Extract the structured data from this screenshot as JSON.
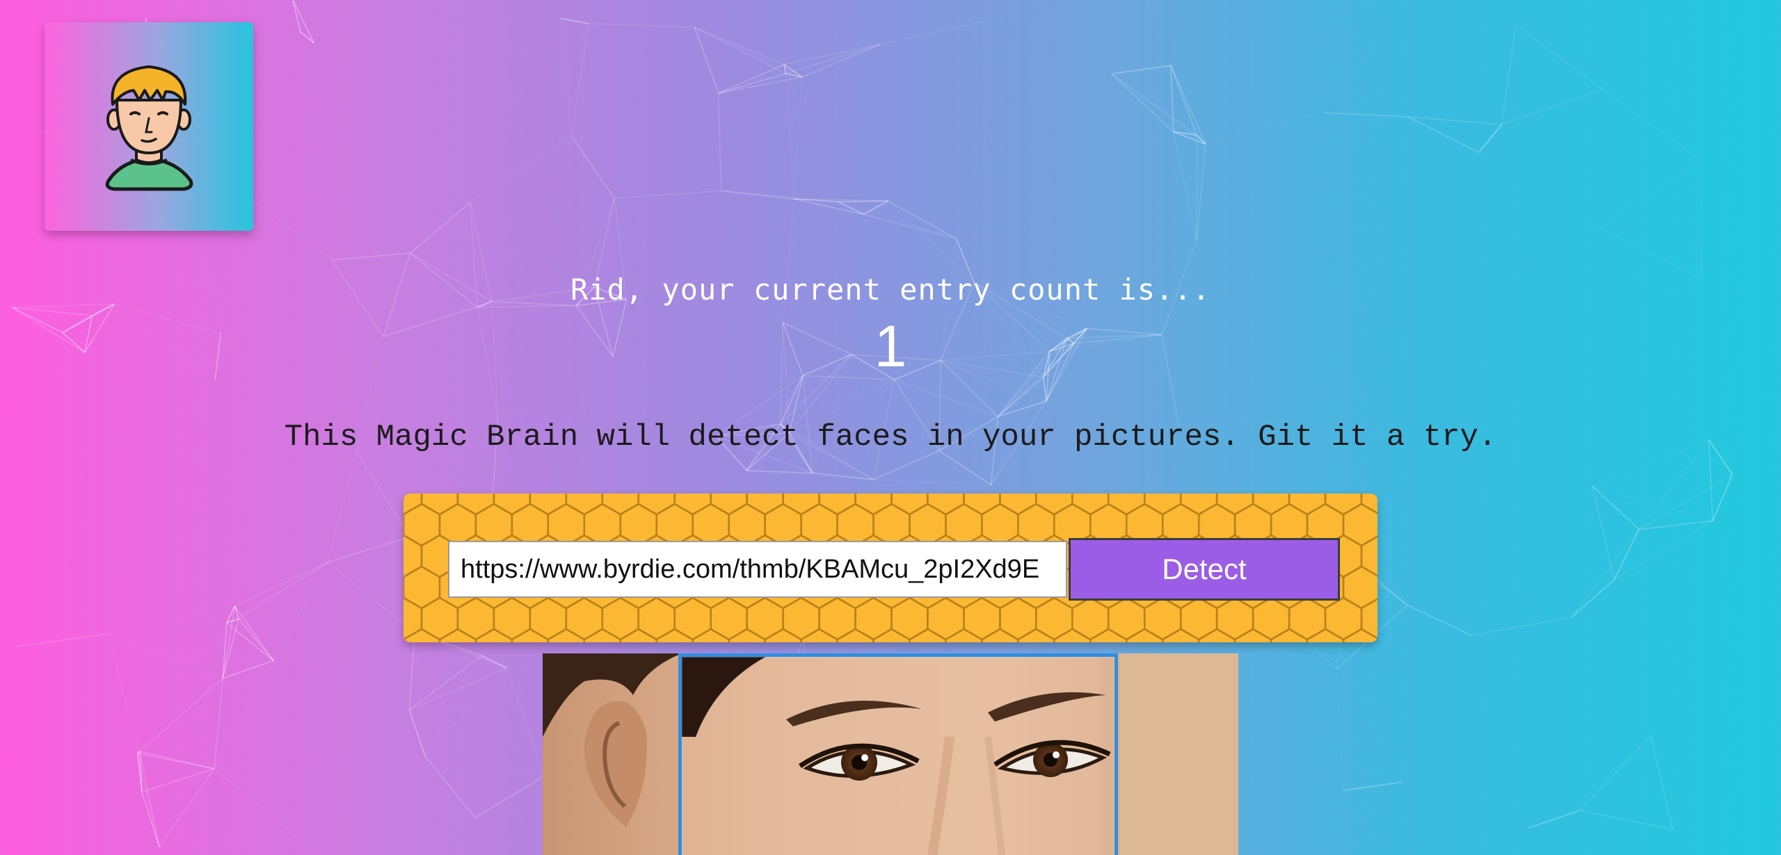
{
  "header": {
    "logo_icon": "brain-face-avatar"
  },
  "rank": {
    "message": "Rid, your current entry count is...",
    "count": "1"
  },
  "tagline": "This Magic Brain will detect faces in your pictures. Git it a try.",
  "image_link_form": {
    "url_value": "https://www.byrdie.com/thmb/KBAMcu_2pI2Xd9E",
    "detect_label": "Detect"
  },
  "colors": {
    "gradient_left": "#ff5edf",
    "gradient_right": "#22c9df",
    "panel": "#fcb833",
    "button": "#9b5de5",
    "bounding_box": "#2f8fe0"
  }
}
